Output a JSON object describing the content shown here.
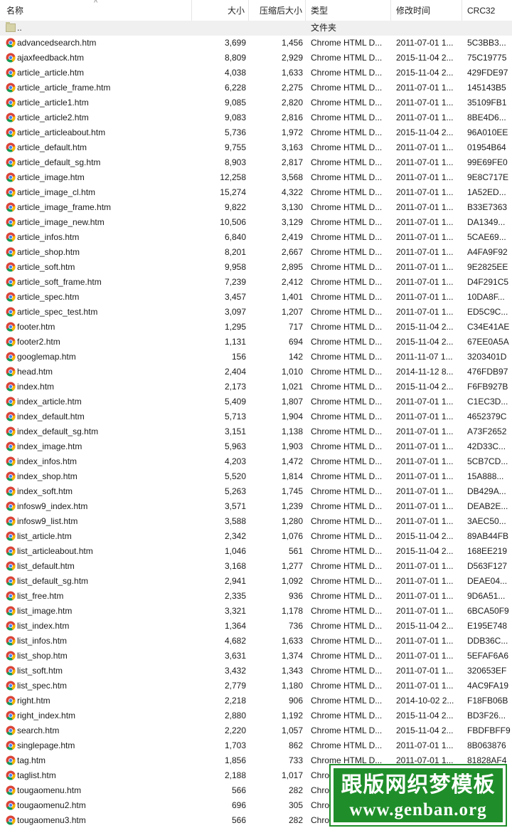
{
  "columns": {
    "name": "名称",
    "size": "大小",
    "compressed": "压缩后大小",
    "type": "类型",
    "modified": "修改时间",
    "crc": "CRC32"
  },
  "parent_row": {
    "name": "..",
    "type": "文件夹"
  },
  "files": [
    {
      "name": "advancedsearch.htm",
      "size": "3,699",
      "csize": "1,456",
      "type": "Chrome HTML D...",
      "date": "2011-07-01 1...",
      "crc": "5C3BB3..."
    },
    {
      "name": "ajaxfeedback.htm",
      "size": "8,809",
      "csize": "2,929",
      "type": "Chrome HTML D...",
      "date": "2015-11-04 2...",
      "crc": "75C19775"
    },
    {
      "name": "article_article.htm",
      "size": "4,038",
      "csize": "1,633",
      "type": "Chrome HTML D...",
      "date": "2015-11-04 2...",
      "crc": "429FDE97"
    },
    {
      "name": "article_article_frame.htm",
      "size": "6,228",
      "csize": "2,275",
      "type": "Chrome HTML D...",
      "date": "2011-07-01 1...",
      "crc": "145143B5"
    },
    {
      "name": "article_article1.htm",
      "size": "9,085",
      "csize": "2,820",
      "type": "Chrome HTML D...",
      "date": "2011-07-01 1...",
      "crc": "35109FB1"
    },
    {
      "name": "article_article2.htm",
      "size": "9,083",
      "csize": "2,816",
      "type": "Chrome HTML D...",
      "date": "2011-07-01 1...",
      "crc": "8BE4D6..."
    },
    {
      "name": "article_articleabout.htm",
      "size": "5,736",
      "csize": "1,972",
      "type": "Chrome HTML D...",
      "date": "2015-11-04 2...",
      "crc": "96A010EE"
    },
    {
      "name": "article_default.htm",
      "size": "9,755",
      "csize": "3,163",
      "type": "Chrome HTML D...",
      "date": "2011-07-01 1...",
      "crc": "01954B64"
    },
    {
      "name": "article_default_sg.htm",
      "size": "8,903",
      "csize": "2,817",
      "type": "Chrome HTML D...",
      "date": "2011-07-01 1...",
      "crc": "99E69FE0"
    },
    {
      "name": "article_image.htm",
      "size": "12,258",
      "csize": "3,568",
      "type": "Chrome HTML D...",
      "date": "2011-07-01 1...",
      "crc": "9E8C717E"
    },
    {
      "name": "article_image_cl.htm",
      "size": "15,274",
      "csize": "4,322",
      "type": "Chrome HTML D...",
      "date": "2011-07-01 1...",
      "crc": "1A52ED..."
    },
    {
      "name": "article_image_frame.htm",
      "size": "9,822",
      "csize": "3,130",
      "type": "Chrome HTML D...",
      "date": "2011-07-01 1...",
      "crc": "B33E7363"
    },
    {
      "name": "article_image_new.htm",
      "size": "10,506",
      "csize": "3,129",
      "type": "Chrome HTML D...",
      "date": "2011-07-01 1...",
      "crc": "DA1349..."
    },
    {
      "name": "article_infos.htm",
      "size": "6,840",
      "csize": "2,419",
      "type": "Chrome HTML D...",
      "date": "2011-07-01 1...",
      "crc": "5CAE69..."
    },
    {
      "name": "article_shop.htm",
      "size": "8,201",
      "csize": "2,667",
      "type": "Chrome HTML D...",
      "date": "2011-07-01 1...",
      "crc": "A4FA9F92"
    },
    {
      "name": "article_soft.htm",
      "size": "9,958",
      "csize": "2,895",
      "type": "Chrome HTML D...",
      "date": "2011-07-01 1...",
      "crc": "9E2825EE"
    },
    {
      "name": "article_soft_frame.htm",
      "size": "7,239",
      "csize": "2,412",
      "type": "Chrome HTML D...",
      "date": "2011-07-01 1...",
      "crc": "D4F291C5"
    },
    {
      "name": "article_spec.htm",
      "size": "3,457",
      "csize": "1,401",
      "type": "Chrome HTML D...",
      "date": "2011-07-01 1...",
      "crc": "10DA8F..."
    },
    {
      "name": "article_spec_test.htm",
      "size": "3,097",
      "csize": "1,207",
      "type": "Chrome HTML D...",
      "date": "2011-07-01 1...",
      "crc": "ED5C9C..."
    },
    {
      "name": "footer.htm",
      "size": "1,295",
      "csize": "717",
      "type": "Chrome HTML D...",
      "date": "2015-11-04 2...",
      "crc": "C34E41AE"
    },
    {
      "name": "footer2.htm",
      "size": "1,131",
      "csize": "694",
      "type": "Chrome HTML D...",
      "date": "2015-11-04 2...",
      "crc": "67EE0A5A"
    },
    {
      "name": "googlemap.htm",
      "size": "156",
      "csize": "142",
      "type": "Chrome HTML D...",
      "date": "2011-11-07 1...",
      "crc": "3203401D"
    },
    {
      "name": "head.htm",
      "size": "2,404",
      "csize": "1,010",
      "type": "Chrome HTML D...",
      "date": "2014-11-12 8...",
      "crc": "476FDB97"
    },
    {
      "name": "index.htm",
      "size": "2,173",
      "csize": "1,021",
      "type": "Chrome HTML D...",
      "date": "2015-11-04 2...",
      "crc": "F6FB927B"
    },
    {
      "name": "index_article.htm",
      "size": "5,409",
      "csize": "1,807",
      "type": "Chrome HTML D...",
      "date": "2011-07-01 1...",
      "crc": "C1EC3D..."
    },
    {
      "name": "index_default.htm",
      "size": "5,713",
      "csize": "1,904",
      "type": "Chrome HTML D...",
      "date": "2011-07-01 1...",
      "crc": "4652379C"
    },
    {
      "name": "index_default_sg.htm",
      "size": "3,151",
      "csize": "1,138",
      "type": "Chrome HTML D...",
      "date": "2011-07-01 1...",
      "crc": "A73F2652"
    },
    {
      "name": "index_image.htm",
      "size": "5,963",
      "csize": "1,903",
      "type": "Chrome HTML D...",
      "date": "2011-07-01 1...",
      "crc": "42D33C..."
    },
    {
      "name": "index_infos.htm",
      "size": "4,203",
      "csize": "1,472",
      "type": "Chrome HTML D...",
      "date": "2011-07-01 1...",
      "crc": "5CB7CD..."
    },
    {
      "name": "index_shop.htm",
      "size": "5,520",
      "csize": "1,814",
      "type": "Chrome HTML D...",
      "date": "2011-07-01 1...",
      "crc": "15A888..."
    },
    {
      "name": "index_soft.htm",
      "size": "5,263",
      "csize": "1,745",
      "type": "Chrome HTML D...",
      "date": "2011-07-01 1...",
      "crc": "DB429A..."
    },
    {
      "name": "infosw9_index.htm",
      "size": "3,571",
      "csize": "1,239",
      "type": "Chrome HTML D...",
      "date": "2011-07-01 1...",
      "crc": "DEAB2E..."
    },
    {
      "name": "infosw9_list.htm",
      "size": "3,588",
      "csize": "1,280",
      "type": "Chrome HTML D...",
      "date": "2011-07-01 1...",
      "crc": "3AEC50..."
    },
    {
      "name": "list_article.htm",
      "size": "2,342",
      "csize": "1,076",
      "type": "Chrome HTML D...",
      "date": "2015-11-04 2...",
      "crc": "89AB44FB"
    },
    {
      "name": "list_articleabout.htm",
      "size": "1,046",
      "csize": "561",
      "type": "Chrome HTML D...",
      "date": "2015-11-04 2...",
      "crc": "168EE219"
    },
    {
      "name": "list_default.htm",
      "size": "3,168",
      "csize": "1,277",
      "type": "Chrome HTML D...",
      "date": "2011-07-01 1...",
      "crc": "D563F127"
    },
    {
      "name": "list_default_sg.htm",
      "size": "2,941",
      "csize": "1,092",
      "type": "Chrome HTML D...",
      "date": "2011-07-01 1...",
      "crc": "DEAE04..."
    },
    {
      "name": "list_free.htm",
      "size": "2,335",
      "csize": "936",
      "type": "Chrome HTML D...",
      "date": "2011-07-01 1...",
      "crc": "9D6A51..."
    },
    {
      "name": "list_image.htm",
      "size": "3,321",
      "csize": "1,178",
      "type": "Chrome HTML D...",
      "date": "2011-07-01 1...",
      "crc": "6BCA50F9"
    },
    {
      "name": "list_index.htm",
      "size": "1,364",
      "csize": "736",
      "type": "Chrome HTML D...",
      "date": "2015-11-04 2...",
      "crc": "E195E748"
    },
    {
      "name": "list_infos.htm",
      "size": "4,682",
      "csize": "1,633",
      "type": "Chrome HTML D...",
      "date": "2011-07-01 1...",
      "crc": "DDB36C..."
    },
    {
      "name": "list_shop.htm",
      "size": "3,631",
      "csize": "1,374",
      "type": "Chrome HTML D...",
      "date": "2011-07-01 1...",
      "crc": "5EFAF6A6"
    },
    {
      "name": "list_soft.htm",
      "size": "3,432",
      "csize": "1,343",
      "type": "Chrome HTML D...",
      "date": "2011-07-01 1...",
      "crc": "320653EF"
    },
    {
      "name": "list_spec.htm",
      "size": "2,779",
      "csize": "1,180",
      "type": "Chrome HTML D...",
      "date": "2011-07-01 1...",
      "crc": "4AC9FA19"
    },
    {
      "name": "right.htm",
      "size": "2,218",
      "csize": "906",
      "type": "Chrome HTML D...",
      "date": "2014-10-02 2...",
      "crc": "F18FB06B"
    },
    {
      "name": "right_index.htm",
      "size": "2,880",
      "csize": "1,192",
      "type": "Chrome HTML D...",
      "date": "2015-11-04 2...",
      "crc": "BD3F26..."
    },
    {
      "name": "search.htm",
      "size": "2,220",
      "csize": "1,057",
      "type": "Chrome HTML D...",
      "date": "2015-11-04 2...",
      "crc": "FBDFBFF9"
    },
    {
      "name": "singlepage.htm",
      "size": "1,703",
      "csize": "862",
      "type": "Chrome HTML D...",
      "date": "2011-07-01 1...",
      "crc": "8B063876"
    },
    {
      "name": "tag.htm",
      "size": "1,856",
      "csize": "733",
      "type": "Chrome HTML D...",
      "date": "2011-07-01 1...",
      "crc": "81828AF4"
    },
    {
      "name": "taglist.htm",
      "size": "2,188",
      "csize": "1,017",
      "type": "Chrome HTML D...",
      "date": "",
      "crc": ""
    },
    {
      "name": "tougaomenu.htm",
      "size": "566",
      "csize": "282",
      "type": "Chrome HTML D...",
      "date": "",
      "crc": ""
    },
    {
      "name": "tougaomenu2.htm",
      "size": "696",
      "csize": "305",
      "type": "Chrome HTML D...",
      "date": "",
      "crc": ""
    },
    {
      "name": "tougaomenu3.htm",
      "size": "566",
      "csize": "282",
      "type": "Chrome HTML D...",
      "date": "",
      "crc": ""
    }
  ],
  "icons": {
    "file": "chrome-icon",
    "folder": "folder-icon",
    "sort": "sort-ascending-icon"
  },
  "watermark": {
    "line1": "跟版网织梦模板",
    "line2": "www.genban.org"
  },
  "colors": {
    "watermark_green": "#1f8e2a",
    "header_border": "#e5e5e5"
  }
}
